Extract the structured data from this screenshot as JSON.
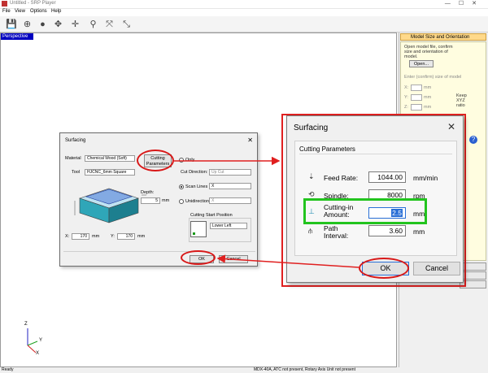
{
  "window": {
    "title": "Untitled - SRP Player",
    "menu": [
      "File",
      "View",
      "Options",
      "Help"
    ],
    "toolbar_icons": [
      "save-icon",
      "globe-icon",
      "sphere-icon",
      "move-view-icon",
      "pan-icon",
      "zoom-icon",
      "fit-icon",
      "zoom-extents-icon"
    ]
  },
  "viewport": {
    "label": "Perspective",
    "axes": [
      "Z",
      "Y",
      "X"
    ]
  },
  "right_panel": {
    "header": "Model Size and Orientation",
    "desc": "Open model file, confirm size and orientation of model.",
    "open_button": "Open...",
    "size_label": "Enter (confirm) size of model",
    "axes": [
      "X:",
      "Y:",
      "Z:"
    ],
    "units": [
      "mm",
      "mm",
      "mm"
    ],
    "keep_label": "Keep XYZ ratio"
  },
  "status": {
    "left": "Ready",
    "center": "MDX-40A, ATC not present, Rotary Axis Unit not present"
  },
  "small_dialog": {
    "title": "Surfacing",
    "material_label": "Material",
    "material_value": "Chemical Wood (Soft)",
    "tool_label": "Tool",
    "tool_value": "HJCNC_6mm Square",
    "cutting_params_button": "Cutting Parameters",
    "only_label": "Only",
    "cut_direction_label": "Cut Direction:",
    "cut_direction_value": "Up Cut",
    "scan_lines_label": "Scan Lines",
    "scan_lines_value": "X",
    "unidirectional_label": "Unidirectional",
    "unidirectional_value": "X",
    "depth_label": "Depth:",
    "depth_value": "5",
    "depth_unit": "mm",
    "x_label": "X:",
    "x_value": "170",
    "x_unit": "mm",
    "y_label": "Y:",
    "y_value": "170",
    "y_unit": "mm",
    "start_pos_label": "Cutting Start Position",
    "start_pos_value": "Lower Left",
    "ok": "OK",
    "cancel": "Cancel"
  },
  "big_dialog": {
    "title": "Surfacing",
    "group_label": "Cutting Parameters",
    "rows": [
      {
        "label": "Feed Rate:",
        "value": "1044.00",
        "unit": "mm/min",
        "icon": "feed-rate-icon"
      },
      {
        "label": "Spindle:",
        "value": "8000",
        "unit": "rpm",
        "icon": "spindle-icon"
      },
      {
        "label": "Cutting-in Amount:",
        "value": "2.5",
        "unit": "mm",
        "icon": "cutting-in-icon"
      },
      {
        "label": "Path Interval:",
        "value": "3.60",
        "unit": "mm",
        "icon": "path-interval-icon"
      }
    ],
    "ok": "OK",
    "cancel": "Cancel"
  },
  "annotation_colors": {
    "red": "#e02020",
    "green": "#22c41e"
  }
}
